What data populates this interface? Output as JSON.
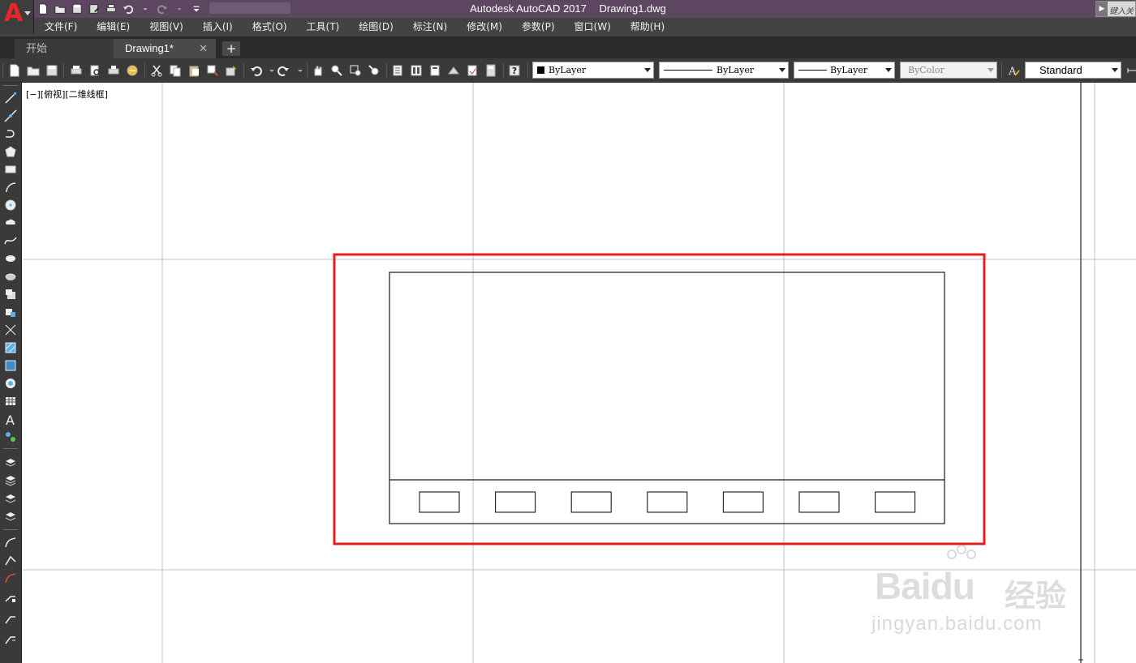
{
  "app": {
    "name": "Autodesk AutoCAD 2017",
    "file": "Drawing1.dwg",
    "logo_letter": "A",
    "search_placeholder": "键入关"
  },
  "menu": [
    "文件(F)",
    "编辑(E)",
    "视图(V)",
    "插入(I)",
    "格式(O)",
    "工具(T)",
    "绘图(D)",
    "标注(N)",
    "修改(M)",
    "参数(P)",
    "窗口(W)",
    "帮助(H)"
  ],
  "tabs": {
    "start": "开始",
    "drawing": "Drawing1*",
    "close": "✕",
    "add": "+"
  },
  "properties": {
    "color": "ByLayer",
    "linetype": "ByLayer",
    "lineweight": "ByLayer",
    "plotstyle": "ByColor",
    "textstyle": "Standard"
  },
  "viewport": {
    "label": "[−][俯视][二维线框]"
  },
  "drawing": {
    "slot_count": 7,
    "highlight_color": "#e02020"
  },
  "watermark": {
    "brand": "Bai",
    "brand2": "du",
    "cn": "经验",
    "url": "jingyan.baidu.com"
  },
  "colors": {
    "titlebar": "#5c4660",
    "menubar": "#434343",
    "toolbar": "#3a3a3a",
    "canvas": "#ffffff",
    "grid": "#c0c0c0"
  }
}
